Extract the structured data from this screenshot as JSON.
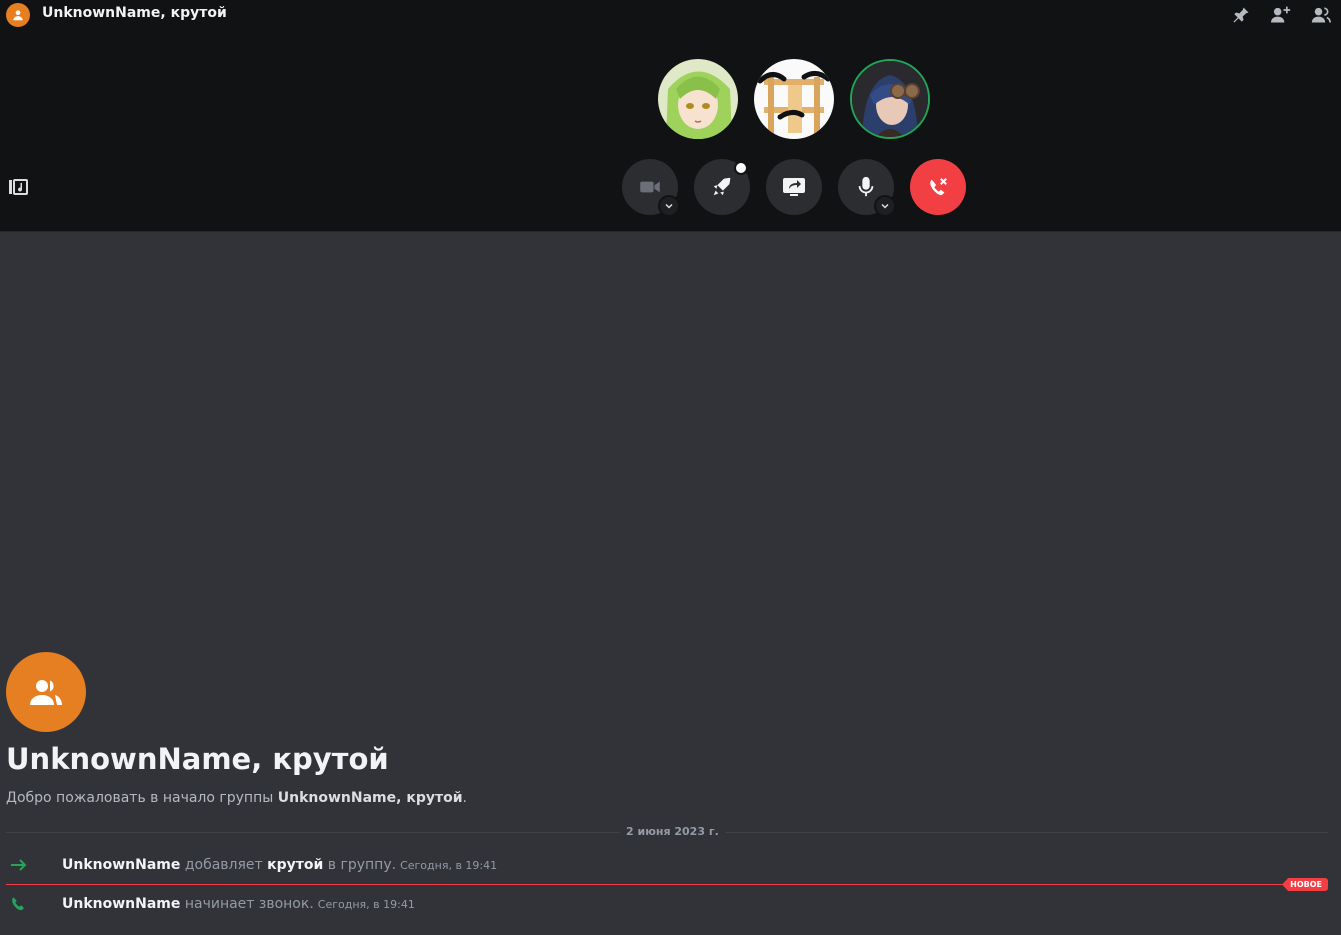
{
  "header": {
    "group_name": "UnknownName, крутой",
    "icons": [
      "pin-icon",
      "add-friend-icon",
      "members-icon"
    ]
  },
  "call": {
    "participants": [
      {
        "name": "green-haired-avatar",
        "speaking": false
      },
      {
        "name": "shelf-face-avatar",
        "speaking": false
      },
      {
        "name": "goggles-avatar",
        "speaking": true
      }
    ],
    "controls": [
      "camera-icon",
      "activity-rocket-icon",
      "screen-share-icon",
      "microphone-icon",
      "leave-call-icon"
    ]
  },
  "welcome": {
    "title": "UnknownName, крутой",
    "text_prefix": "Добро пожаловать в начало группы ",
    "text_group": "UnknownName, крутой",
    "text_suffix": "."
  },
  "divider_date": "2 июня 2023 г.",
  "messages": [
    {
      "actor": "UnknownName",
      "action": " добавляет ",
      "target": "крутой",
      "rest": " в группу.",
      "time": "Сегодня, в 19:41"
    },
    {
      "actor": "UnknownName",
      "action": " начинает звонок.",
      "time": "Сегодня, в 19:41"
    }
  ],
  "new_badge": "НОВОЕ",
  "colors": {
    "call_bg": "#111214",
    "chat_bg": "#313338",
    "group_orange": "#e67e22",
    "danger_red": "#f23f43",
    "green": "#23a55a"
  }
}
